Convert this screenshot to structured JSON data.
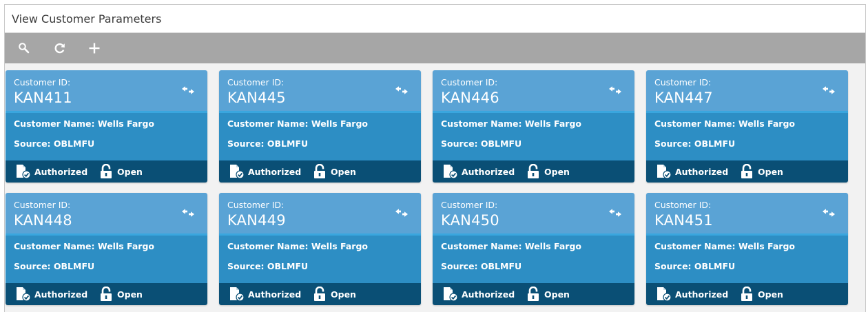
{
  "header": {
    "title": "View Customer Parameters"
  },
  "toolbar": {
    "buttons": [
      {
        "icon": "search-icon"
      },
      {
        "icon": "refresh-icon"
      },
      {
        "icon": "plus-icon"
      }
    ]
  },
  "labels": {
    "customer_id": "Customer ID:",
    "customer_name": "Customer Name:",
    "source": "Source:"
  },
  "cards": [
    {
      "customer_id": "KAN411",
      "customer_name": "Wells Fargo",
      "source": "OBLMFU",
      "auth_status": "Authorized",
      "record_status": "Open"
    },
    {
      "customer_id": "KAN445",
      "customer_name": "Wells Fargo",
      "source": "OBLMFU",
      "auth_status": "Authorized",
      "record_status": "Open"
    },
    {
      "customer_id": "KAN446",
      "customer_name": "Wells Fargo",
      "source": "OBLMFU",
      "auth_status": "Authorized",
      "record_status": "Open"
    },
    {
      "customer_id": "KAN447",
      "customer_name": "Wells Fargo",
      "source": "OBLMFU",
      "auth_status": "Authorized",
      "record_status": "Open"
    },
    {
      "customer_id": "KAN448",
      "customer_name": "Wells Fargo",
      "source": "OBLMFU",
      "auth_status": "Authorized",
      "record_status": "Open"
    },
    {
      "customer_id": "KAN449",
      "customer_name": "Wells Fargo",
      "source": "OBLMFU",
      "auth_status": "Authorized",
      "record_status": "Open"
    },
    {
      "customer_id": "KAN450",
      "customer_name": "Wells Fargo",
      "source": "OBLMFU",
      "auth_status": "Authorized",
      "record_status": "Open"
    },
    {
      "customer_id": "KAN451",
      "customer_name": "Wells Fargo",
      "source": "OBLMFU",
      "auth_status": "Authorized",
      "record_status": "Open"
    }
  ],
  "colors": {
    "toolbar_bg": "#a6a6a6",
    "card_head": "#5aa3d5",
    "card_body": "#2d8ec4",
    "card_foot": "#0a4f75"
  }
}
